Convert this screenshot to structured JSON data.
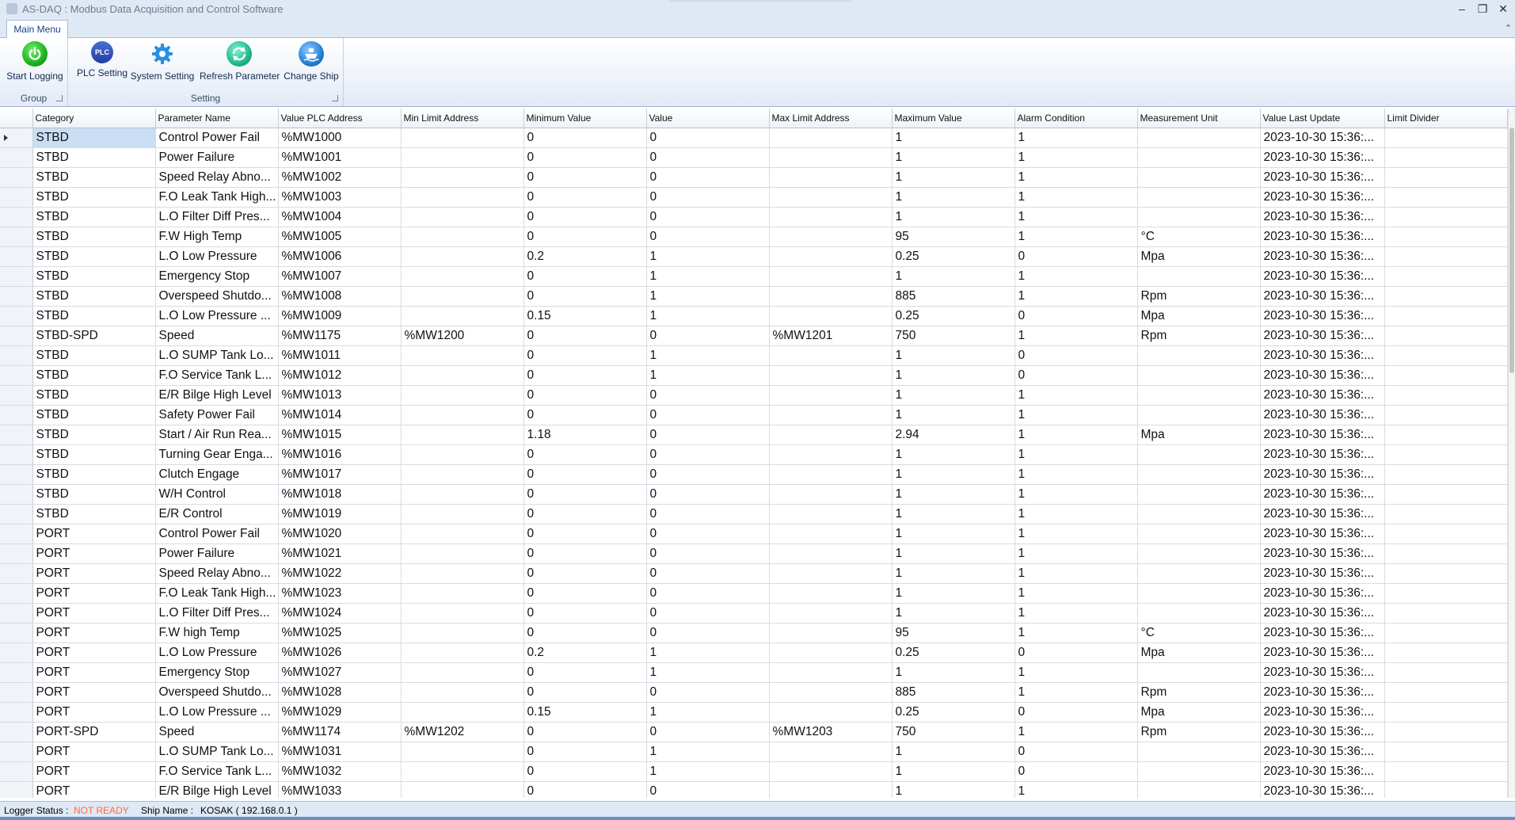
{
  "window": {
    "title": "AS-DAQ : Modbus Data Acquisition and Control Software",
    "minimize": "–",
    "restore": "❐",
    "close": "✕"
  },
  "ribbon": {
    "tab": "Main Menu",
    "collapse": "⌃",
    "groups": {
      "group": {
        "label": "Group",
        "buttons": {
          "start_logging": "Start Logging"
        }
      },
      "setting": {
        "label": "Setting",
        "buttons": {
          "plc_setting": "PLC Setting",
          "system_setting": "System Setting",
          "refresh_parameter": "Refresh Parameter",
          "change_ship": "Change Ship"
        },
        "plc_icon_text": "PLC"
      }
    }
  },
  "grid": {
    "columns": [
      "Category",
      "Parameter Name",
      "Value PLC Address",
      "Min Limit Address",
      "Minimum Value",
      "Value",
      "Max Limit Address",
      "Maximum Value",
      "Alarm Condition",
      "Measurement Unit",
      "Value Last Update",
      "Limit Divider"
    ],
    "rows": [
      [
        "STBD",
        "Control Power Fail",
        "%MW1000",
        "",
        "0",
        "0",
        "",
        "1",
        "1",
        "",
        "2023-10-30 15:36:...",
        ""
      ],
      [
        "STBD",
        "Power Failure",
        "%MW1001",
        "",
        "0",
        "0",
        "",
        "1",
        "1",
        "",
        "2023-10-30 15:36:...",
        ""
      ],
      [
        "STBD",
        "Speed Relay Abno...",
        "%MW1002",
        "",
        "0",
        "0",
        "",
        "1",
        "1",
        "",
        "2023-10-30 15:36:...",
        ""
      ],
      [
        "STBD",
        "F.O Leak Tank High...",
        "%MW1003",
        "",
        "0",
        "0",
        "",
        "1",
        "1",
        "",
        "2023-10-30 15:36:...",
        ""
      ],
      [
        "STBD",
        "L.O Filter Diff Pres...",
        "%MW1004",
        "",
        "0",
        "0",
        "",
        "1",
        "1",
        "",
        "2023-10-30 15:36:...",
        ""
      ],
      [
        "STBD",
        "F.W High Temp",
        "%MW1005",
        "",
        "0",
        "0",
        "",
        "95",
        "1",
        "°C",
        "2023-10-30 15:36:...",
        ""
      ],
      [
        "STBD",
        "L.O Low Pressure",
        "%MW1006",
        "",
        "0.2",
        "1",
        "",
        "0.25",
        "0",
        "Mpa",
        "2023-10-30 15:36:...",
        ""
      ],
      [
        "STBD",
        "Emergency Stop",
        "%MW1007",
        "",
        "0",
        "1",
        "",
        "1",
        "1",
        "",
        "2023-10-30 15:36:...",
        ""
      ],
      [
        "STBD",
        "Overspeed Shutdo...",
        "%MW1008",
        "",
        "0",
        "1",
        "",
        "885",
        "1",
        "Rpm",
        "2023-10-30 15:36:...",
        ""
      ],
      [
        "STBD",
        "L.O Low Pressure ...",
        "%MW1009",
        "",
        "0.15",
        "1",
        "",
        "0.25",
        "0",
        "Mpa",
        "2023-10-30 15:36:...",
        ""
      ],
      [
        "STBD-SPD",
        "Speed",
        "%MW1175",
        "%MW1200",
        "0",
        "0",
        "%MW1201",
        "750",
        "1",
        "Rpm",
        "2023-10-30 15:36:...",
        ""
      ],
      [
        "STBD",
        "L.O SUMP Tank Lo...",
        "%MW1011",
        "",
        "0",
        "1",
        "",
        "1",
        "0",
        "",
        "2023-10-30 15:36:...",
        ""
      ],
      [
        "STBD",
        "F.O Service Tank L...",
        "%MW1012",
        "",
        "0",
        "1",
        "",
        "1",
        "0",
        "",
        "2023-10-30 15:36:...",
        ""
      ],
      [
        "STBD",
        "E/R Bilge High Level",
        "%MW1013",
        "",
        "0",
        "0",
        "",
        "1",
        "1",
        "",
        "2023-10-30 15:36:...",
        ""
      ],
      [
        "STBD",
        "Safety Power Fail",
        "%MW1014",
        "",
        "0",
        "0",
        "",
        "1",
        "1",
        "",
        "2023-10-30 15:36:...",
        ""
      ],
      [
        "STBD",
        "Start / Air Run Rea...",
        "%MW1015",
        "",
        "1.18",
        "0",
        "",
        "2.94",
        "1",
        "Mpa",
        "2023-10-30 15:36:...",
        ""
      ],
      [
        "STBD",
        "Turning Gear Enga...",
        "%MW1016",
        "",
        "0",
        "0",
        "",
        "1",
        "1",
        "",
        "2023-10-30 15:36:...",
        ""
      ],
      [
        "STBD",
        "Clutch Engage",
        "%MW1017",
        "",
        "0",
        "0",
        "",
        "1",
        "1",
        "",
        "2023-10-30 15:36:...",
        ""
      ],
      [
        "STBD",
        "W/H Control",
        "%MW1018",
        "",
        "0",
        "0",
        "",
        "1",
        "1",
        "",
        "2023-10-30 15:36:...",
        ""
      ],
      [
        "STBD",
        "E/R Control",
        "%MW1019",
        "",
        "0",
        "0",
        "",
        "1",
        "1",
        "",
        "2023-10-30 15:36:...",
        ""
      ],
      [
        "PORT",
        "Control Power Fail",
        "%MW1020",
        "",
        "0",
        "0",
        "",
        "1",
        "1",
        "",
        "2023-10-30 15:36:...",
        ""
      ],
      [
        "PORT",
        "Power Failure",
        "%MW1021",
        "",
        "0",
        "0",
        "",
        "1",
        "1",
        "",
        "2023-10-30 15:36:...",
        ""
      ],
      [
        "PORT",
        "Speed Relay Abno...",
        "%MW1022",
        "",
        "0",
        "0",
        "",
        "1",
        "1",
        "",
        "2023-10-30 15:36:...",
        ""
      ],
      [
        "PORT",
        "F.O Leak Tank High...",
        "%MW1023",
        "",
        "0",
        "0",
        "",
        "1",
        "1",
        "",
        "2023-10-30 15:36:...",
        ""
      ],
      [
        "PORT",
        "L.O Filter Diff Pres...",
        "%MW1024",
        "",
        "0",
        "0",
        "",
        "1",
        "1",
        "",
        "2023-10-30 15:36:...",
        ""
      ],
      [
        "PORT",
        "F.W high Temp",
        "%MW1025",
        "",
        "0",
        "0",
        "",
        "95",
        "1",
        "°C",
        "2023-10-30 15:36:...",
        ""
      ],
      [
        "PORT",
        "L.O Low Pressure",
        "%MW1026",
        "",
        "0.2",
        "1",
        "",
        "0.25",
        "0",
        "Mpa",
        "2023-10-30 15:36:...",
        ""
      ],
      [
        "PORT",
        "Emergency Stop",
        "%MW1027",
        "",
        "0",
        "1",
        "",
        "1",
        "1",
        "",
        "2023-10-30 15:36:...",
        ""
      ],
      [
        "PORT",
        "Overspeed Shutdo...",
        "%MW1028",
        "",
        "0",
        "0",
        "",
        "885",
        "1",
        "Rpm",
        "2023-10-30 15:36:...",
        ""
      ],
      [
        "PORT",
        "L.O Low Pressure ...",
        "%MW1029",
        "",
        "0.15",
        "1",
        "",
        "0.25",
        "0",
        "Mpa",
        "2023-10-30 15:36:...",
        ""
      ],
      [
        "PORT-SPD",
        "Speed",
        "%MW1174",
        "%MW1202",
        "0",
        "0",
        "%MW1203",
        "750",
        "1",
        "Rpm",
        "2023-10-30 15:36:...",
        ""
      ],
      [
        "PORT",
        "L.O SUMP Tank Lo...",
        "%MW1031",
        "",
        "0",
        "1",
        "",
        "1",
        "0",
        "",
        "2023-10-30 15:36:...",
        ""
      ],
      [
        "PORT",
        "F.O Service Tank L...",
        "%MW1032",
        "",
        "0",
        "1",
        "",
        "1",
        "0",
        "",
        "2023-10-30 15:36:...",
        ""
      ],
      [
        "PORT",
        "E/R Bilge High Level",
        "%MW1033",
        "",
        "0",
        "0",
        "",
        "1",
        "1",
        "",
        "2023-10-30 15:36:...",
        ""
      ]
    ]
  },
  "statusbar": {
    "logger_label": "Logger Status  :",
    "logger_value": "NOT READY",
    "ship_label": "Ship Name  :",
    "ship_value": "KOSAK ( 192.168.0.1 )"
  },
  "colors": {
    "not_ready": "#ff6a3d",
    "selected_cell": "#c9def5",
    "ribbon_bg": "#dfe9f5"
  }
}
